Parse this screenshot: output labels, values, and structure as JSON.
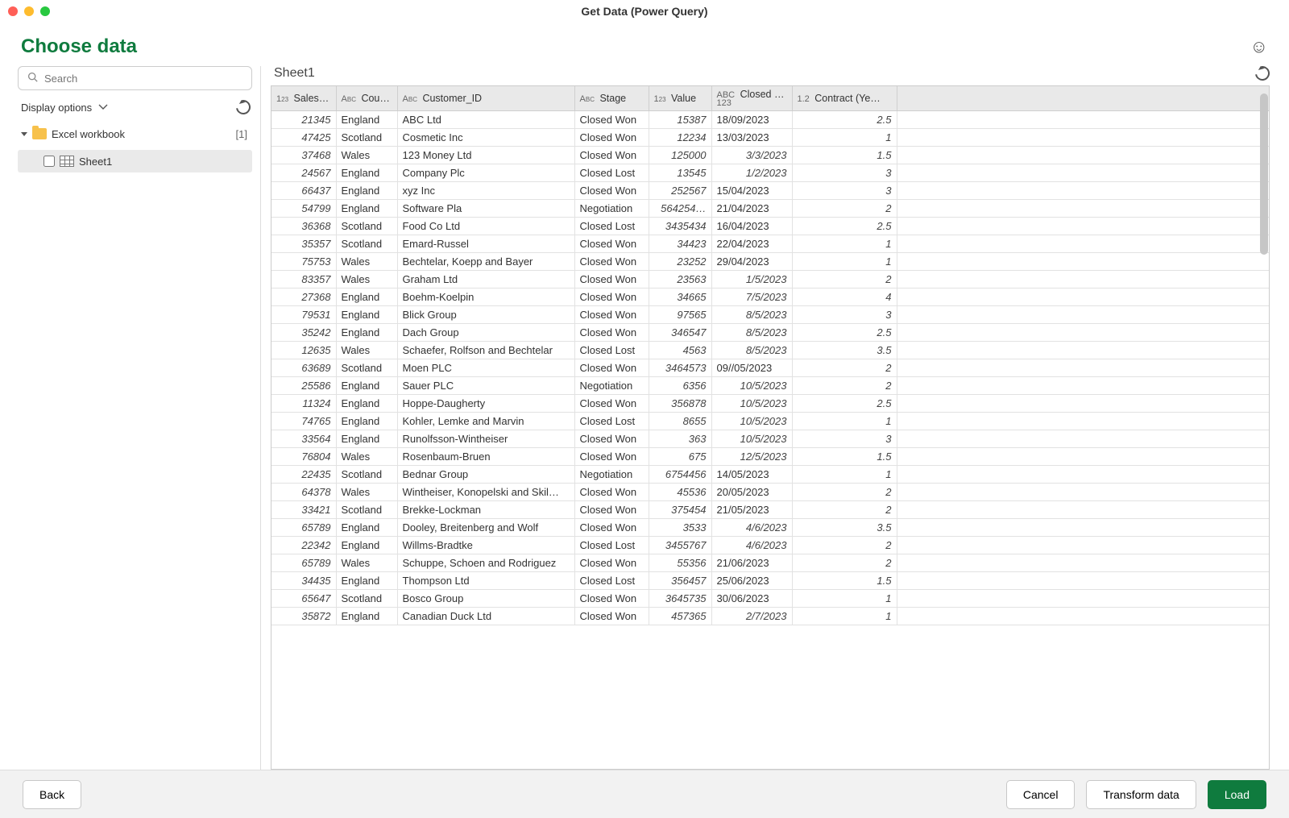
{
  "window_title": "Get Data (Power Query)",
  "page_heading": "Choose data",
  "search_placeholder": "Search",
  "display_options_label": "Display options",
  "navigator": {
    "root_label": "Excel workbook",
    "root_count": "[1]",
    "leaf_label": "Sheet1",
    "leaf_checked": false
  },
  "preview": {
    "sheet_name": "Sheet1",
    "columns": [
      {
        "type": "num",
        "label": "Sales…"
      },
      {
        "type": "text",
        "label": "Coun…"
      },
      {
        "type": "text",
        "label": "Customer_ID"
      },
      {
        "type": "text",
        "label": "Stage"
      },
      {
        "type": "num",
        "label": "Value"
      },
      {
        "type": "abcnum",
        "label": "Closed D…"
      },
      {
        "type": "dec",
        "label": "Contract (Ye…"
      }
    ],
    "rows": [
      [
        "21345",
        "England",
        "ABC Ltd",
        "Closed Won",
        "15387",
        "18/09/2023",
        "2.5"
      ],
      [
        "47425",
        "Scotland",
        "Cosmetic Inc",
        "Closed Won",
        "12234",
        "13/03/2023",
        "1"
      ],
      [
        "37468",
        "Wales",
        "123 Money Ltd",
        "Closed Won",
        "125000",
        "3/3/2023",
        "1.5"
      ],
      [
        "24567",
        "England",
        "Company Plc",
        "Closed Lost",
        "13545",
        "1/2/2023",
        "3"
      ],
      [
        "66437",
        "England",
        "xyz Inc",
        "Closed Won",
        "252567",
        "15/04/2023",
        "3"
      ],
      [
        "54799",
        "England",
        "Software Pla",
        "Negotiation",
        "564254…",
        "21/04/2023",
        "2"
      ],
      [
        "36368",
        "Scotland",
        "Food Co Ltd",
        "Closed Lost",
        "3435434",
        "16/04/2023",
        "2.5"
      ],
      [
        "35357",
        "Scotland",
        "Emard-Russel",
        "Closed Won",
        "34423",
        "22/04/2023",
        "1"
      ],
      [
        "75753",
        "Wales",
        "Bechtelar, Koepp and Bayer",
        "Closed Won",
        "23252",
        "29/04/2023",
        "1"
      ],
      [
        "83357",
        "Wales",
        "Graham Ltd",
        "Closed Won",
        "23563",
        "1/5/2023",
        "2"
      ],
      [
        "27368",
        "England",
        "Boehm-Koelpin",
        "Closed Won",
        "34665",
        "7/5/2023",
        "4"
      ],
      [
        "79531",
        "England",
        "Blick Group",
        "Closed Won",
        "97565",
        "8/5/2023",
        "3"
      ],
      [
        "35242",
        "England",
        "Dach Group",
        "Closed Won",
        "346547",
        "8/5/2023",
        "2.5"
      ],
      [
        "12635",
        "Wales",
        "Schaefer, Rolfson and Bechtelar",
        "Closed Lost",
        "4563",
        "8/5/2023",
        "3.5"
      ],
      [
        "63689",
        "Scotland",
        "Moen PLC",
        "Closed Won",
        "3464573",
        "09//05/2023",
        "2"
      ],
      [
        "25586",
        "England",
        "Sauer PLC",
        "Negotiation",
        "6356",
        "10/5/2023",
        "2"
      ],
      [
        "11324",
        "England",
        "Hoppe-Daugherty",
        "Closed Won",
        "356878",
        "10/5/2023",
        "2.5"
      ],
      [
        "74765",
        "England",
        "Kohler, Lemke and Marvin",
        "Closed Lost",
        "8655",
        "10/5/2023",
        "1"
      ],
      [
        "33564",
        "England",
        "Runolfsson-Wintheiser",
        "Closed Won",
        "363",
        "10/5/2023",
        "3"
      ],
      [
        "76804",
        "Wales",
        "Rosenbaum-Bruen",
        "Closed Won",
        "675",
        "12/5/2023",
        "1.5"
      ],
      [
        "22435",
        "Scotland",
        "Bednar Group",
        "Negotiation",
        "6754456",
        "14/05/2023",
        "1"
      ],
      [
        "64378",
        "Wales",
        "Wintheiser, Konopelski and Skil…",
        "Closed Won",
        "45536",
        "20/05/2023",
        "2"
      ],
      [
        "33421",
        "Scotland",
        "Brekke-Lockman",
        "Closed Won",
        "375454",
        "21/05/2023",
        "2"
      ],
      [
        "65789",
        "England",
        "Dooley, Breitenberg and Wolf",
        "Closed Won",
        "3533",
        "4/6/2023",
        "3.5"
      ],
      [
        "22342",
        "England",
        "Willms-Bradtke",
        "Closed Lost",
        "3455767",
        "4/6/2023",
        "2"
      ],
      [
        "65789",
        "Wales",
        "Schuppe, Schoen and Rodriguez",
        "Closed Won",
        "55356",
        "21/06/2023",
        "2"
      ],
      [
        "34435",
        "England",
        "Thompson Ltd",
        "Closed Lost",
        "356457",
        "25/06/2023",
        "1.5"
      ],
      [
        "65647",
        "Scotland",
        "Bosco Group",
        "Closed Won",
        "3645735",
        "30/06/2023",
        "1"
      ],
      [
        "35872",
        "England",
        "Canadian Duck Ltd",
        "Closed Won",
        "457365",
        "2/7/2023",
        "1"
      ]
    ]
  },
  "footer": {
    "back": "Back",
    "cancel": "Cancel",
    "transform": "Transform data",
    "load": "Load"
  }
}
